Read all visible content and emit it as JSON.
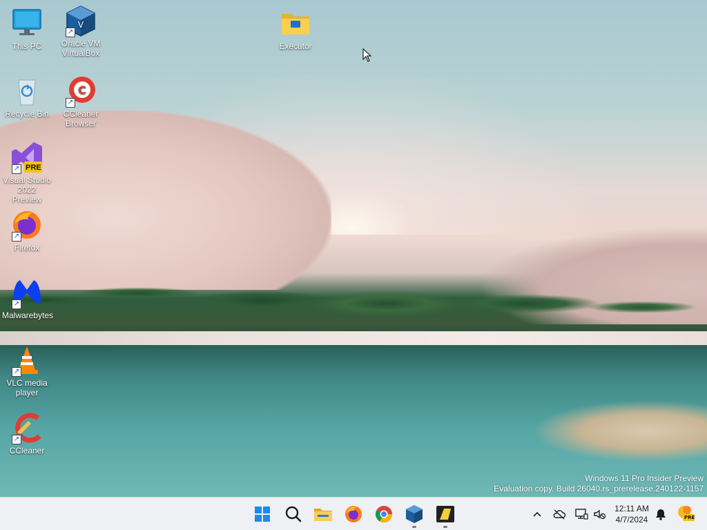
{
  "desktop_icons": [
    {
      "label": "This PC",
      "icon": "this-pc-icon",
      "shortcut": false
    },
    {
      "label": "Oracle VM VirtualBox",
      "icon": "virtualbox-icon",
      "shortcut": true
    },
    {
      "label": "Executor",
      "icon": "folder-icon",
      "shortcut": false
    },
    {
      "label": "Recycle Bin",
      "icon": "recycle-bin-icon",
      "shortcut": false
    },
    {
      "label": "CCleaner Browser",
      "icon": "ccleaner-browser-icon",
      "shortcut": true
    },
    {
      "label": "Visual Studio 2022 Preview",
      "icon": "visual-studio-icon",
      "shortcut": true,
      "badge": "PRE"
    },
    {
      "label": "Firefox",
      "icon": "firefox-icon",
      "shortcut": true
    },
    {
      "label": "Malwarebytes",
      "icon": "malwarebytes-icon",
      "shortcut": true
    },
    {
      "label": "VLC media player",
      "icon": "vlc-icon",
      "shortcut": true
    },
    {
      "label": "CCleaner",
      "icon": "ccleaner-icon",
      "shortcut": true
    }
  ],
  "watermark": {
    "line1": "Windows 11 Pro Insider Preview",
    "line2": "Evaluation copy. Build 26040.rs_prerelease.240122-1157"
  },
  "taskbar": {
    "pinned": [
      {
        "name": "start",
        "icon": "windows-start-icon",
        "running": false
      },
      {
        "name": "search",
        "icon": "search-icon",
        "running": false
      },
      {
        "name": "file-explorer",
        "icon": "folder-icon",
        "running": false
      },
      {
        "name": "firefox",
        "icon": "firefox-icon",
        "running": false
      },
      {
        "name": "chrome",
        "icon": "chrome-icon",
        "running": false
      },
      {
        "name": "virtualbox",
        "icon": "virtualbox-icon",
        "running": true
      },
      {
        "name": "notes-app",
        "icon": "notes-icon",
        "running": true
      }
    ],
    "tray": {
      "icons": [
        "chevron-up-icon",
        "cloud-offline-icon",
        "network-icon",
        "volume-muted-icon",
        "notification-bell-icon",
        "copilot-pre-icon"
      ],
      "time": "12:11 AM",
      "date": "4/7/2024",
      "copilot_badge": "PRE"
    }
  }
}
